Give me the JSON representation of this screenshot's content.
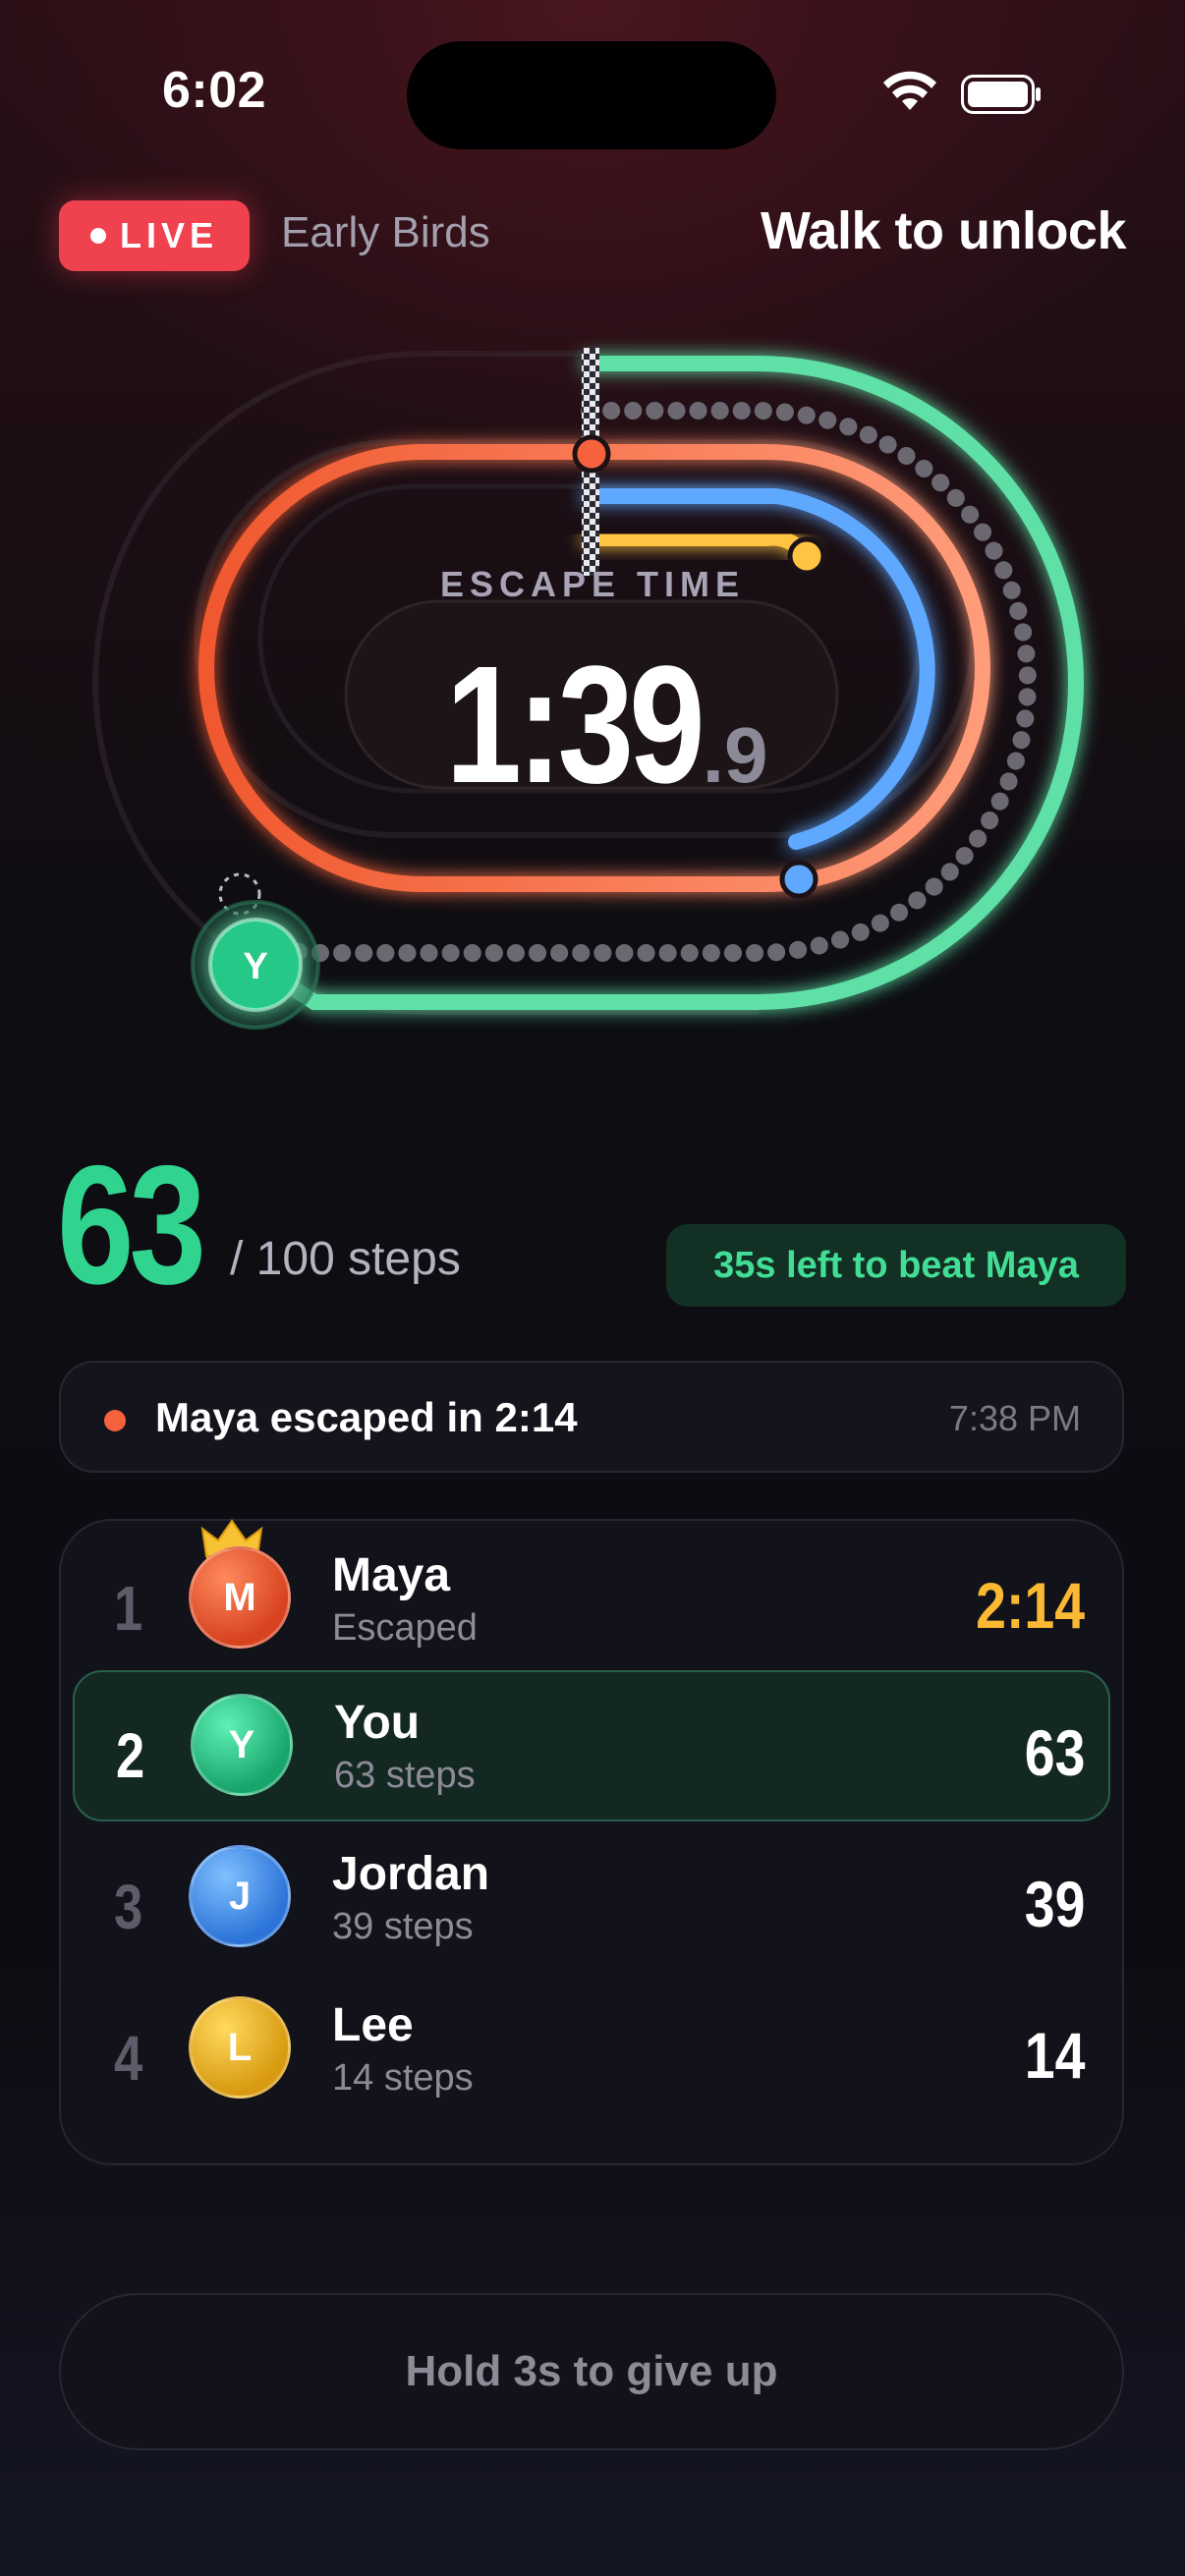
{
  "status_bar": {
    "time": "6:02"
  },
  "header": {
    "live_label": "LIVE",
    "room_name": "Early Birds",
    "title": "Walk to unlock"
  },
  "timer": {
    "label": "ESCAPE TIME",
    "main": "1:39",
    "fraction": ".9"
  },
  "runner": {
    "initial": "Y"
  },
  "progress": {
    "steps": "63",
    "total_label": "/ 100 steps",
    "steps_value": 63,
    "steps_goal": 100,
    "beat_message": "35s left to beat Maya"
  },
  "event": {
    "text": "Maya escaped in 2:14",
    "time": "7:38 PM"
  },
  "leaderboard": [
    {
      "rank": "1",
      "initial": "M",
      "name": "Maya",
      "status": "Escaped",
      "score": "2:14",
      "color": "#e8572f"
    },
    {
      "rank": "2",
      "initial": "Y",
      "name": "You",
      "status": "63 steps",
      "score": "63",
      "color": "#22c283"
    },
    {
      "rank": "3",
      "initial": "J",
      "name": "Jordan",
      "status": "39 steps",
      "score": "39",
      "color": "#3c8fe6"
    },
    {
      "rank": "4",
      "initial": "L",
      "name": "Lee",
      "status": "14 steps",
      "score": "14",
      "color": "#e7b21f"
    }
  ],
  "give_up": {
    "label": "Hold 3s to give up"
  },
  "colors": {
    "accent_green": "#30d48e",
    "live_red": "#f0414f",
    "gold": "#fbb833",
    "blue": "#5fa8ff",
    "orange": "#f5623b"
  }
}
